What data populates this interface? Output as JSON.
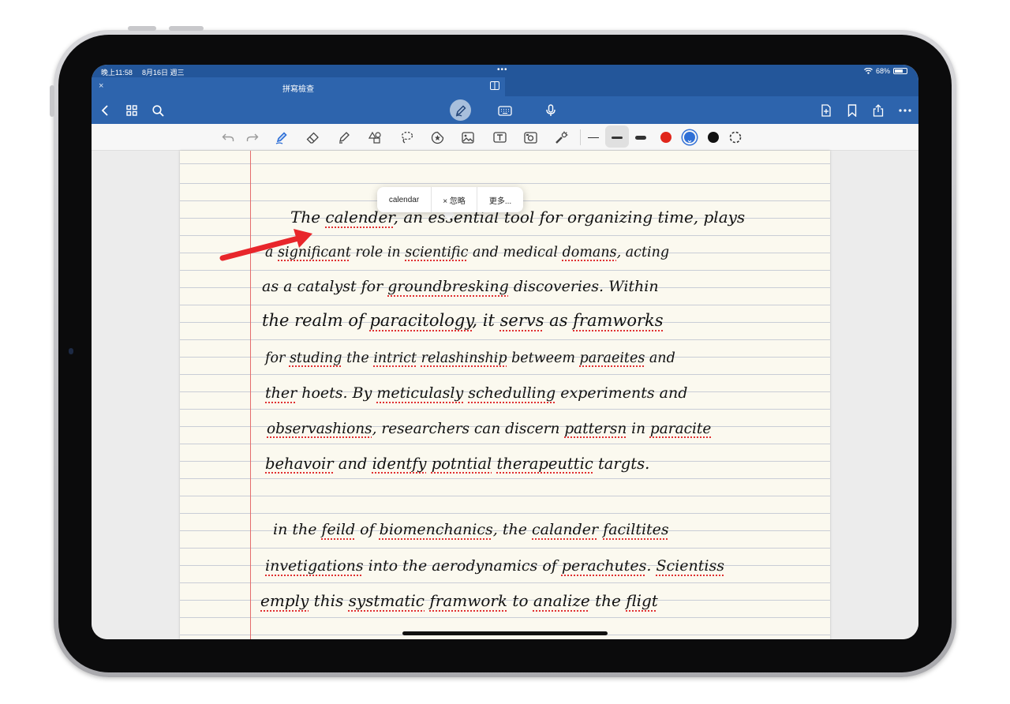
{
  "status": {
    "time": "晚上11:58",
    "date": "8月16日 週三",
    "dots": "•••",
    "battery": "68%",
    "battery_level": 0.68
  },
  "tab": {
    "close": "×",
    "title": "拼寫檢查"
  },
  "nav": {
    "left_icons": [
      "back-icon",
      "grid-icon",
      "search-icon"
    ],
    "center_icons": [
      "pen-mode-icon",
      "keyboard-icon",
      "microphone-icon"
    ],
    "right_icons": [
      "add-page-icon",
      "bookmark-icon",
      "share-icon",
      "more-icon"
    ]
  },
  "toolbar": {
    "tools": [
      "undo-icon",
      "redo-icon",
      "pen-icon",
      "eraser-icon",
      "highlighter-icon",
      "shapes-icon",
      "lasso-icon",
      "sticker-icon",
      "image-icon",
      "text-box-icon",
      "camera-icon",
      "laser-pointer-icon"
    ],
    "colors": [
      "#e0261b",
      "#2f6fd6",
      "#111111"
    ]
  },
  "spellcheck_popup": {
    "suggestion": "calendar",
    "ignore": "× 忽略",
    "more": "更多..."
  },
  "note": {
    "lines": [
      [
        {
          "t": "The "
        },
        {
          "t": "calender",
          "s": 1
        },
        {
          "t": ", an essential tool for organizing time, plays"
        }
      ],
      [
        {
          "t": "a "
        },
        {
          "t": "significant",
          "s": 1
        },
        {
          "t": " role in "
        },
        {
          "t": "scientific",
          "s": 1
        },
        {
          "t": " and medical "
        },
        {
          "t": "domans",
          "s": 1
        },
        {
          "t": ", acting"
        }
      ],
      [
        {
          "t": "as a catalyst for "
        },
        {
          "t": "groundbresking",
          "s": 1
        },
        {
          "t": " discoveries. Within"
        }
      ],
      [
        {
          "t": "the realm of "
        },
        {
          "t": "paracitology",
          "s": 1
        },
        {
          "t": ", it "
        },
        {
          "t": "servs",
          "s": 1
        },
        {
          "t": " as "
        },
        {
          "t": "framworks",
          "s": 1
        }
      ],
      [
        {
          "t": "for "
        },
        {
          "t": "studing",
          "s": 1
        },
        {
          "t": " the "
        },
        {
          "t": "intrict",
          "s": 1
        },
        {
          "t": " "
        },
        {
          "t": "relashinship",
          "s": 1
        },
        {
          "t": " betweem "
        },
        {
          "t": "paraeites",
          "s": 1
        },
        {
          "t": " and"
        }
      ],
      [
        {
          "t": "ther",
          "s": 1
        },
        {
          "t": " hoets. By "
        },
        {
          "t": "meticulasly",
          "s": 1
        },
        {
          "t": " "
        },
        {
          "t": "schedulling",
          "s": 1
        },
        {
          "t": " experiments and"
        }
      ],
      [
        {
          "t": "observashions",
          "s": 1
        },
        {
          "t": ", researchers can discern "
        },
        {
          "t": "pattersn",
          "s": 1
        },
        {
          "t": " in "
        },
        {
          "t": "paracite",
          "s": 1
        }
      ],
      [
        {
          "t": "behavoir",
          "s": 1
        },
        {
          "t": " and "
        },
        {
          "t": "identfy",
          "s": 1
        },
        {
          "t": " "
        },
        {
          "t": "potntial",
          "s": 1
        },
        {
          "t": " "
        },
        {
          "t": "therapeuttic",
          "s": 1
        },
        {
          "t": " targts."
        }
      ],
      [],
      [
        {
          "t": "in the "
        },
        {
          "t": "feild",
          "s": 1
        },
        {
          "t": " of "
        },
        {
          "t": "biomenchanics",
          "s": 1
        },
        {
          "t": ", the "
        },
        {
          "t": "calander",
          "s": 1
        },
        {
          "t": " "
        },
        {
          "t": "faciltites",
          "s": 1
        }
      ],
      [
        {
          "t": "invetigations",
          "s": 1
        },
        {
          "t": " into the aerodynamics of "
        },
        {
          "t": "perachutes",
          "s": 1
        },
        {
          "t": ". "
        },
        {
          "t": "Scientiss",
          "s": 1
        }
      ],
      [
        {
          "t": "emply",
          "s": 1
        },
        {
          "t": " this "
        },
        {
          "t": "systmatic",
          "s": 1
        },
        {
          "t": " "
        },
        {
          "t": "framwork",
          "s": 1
        },
        {
          "t": " to "
        },
        {
          "t": "analize",
          "s": 1
        },
        {
          "t": " the "
        },
        {
          "t": "fligt",
          "s": 1
        }
      ]
    ]
  }
}
